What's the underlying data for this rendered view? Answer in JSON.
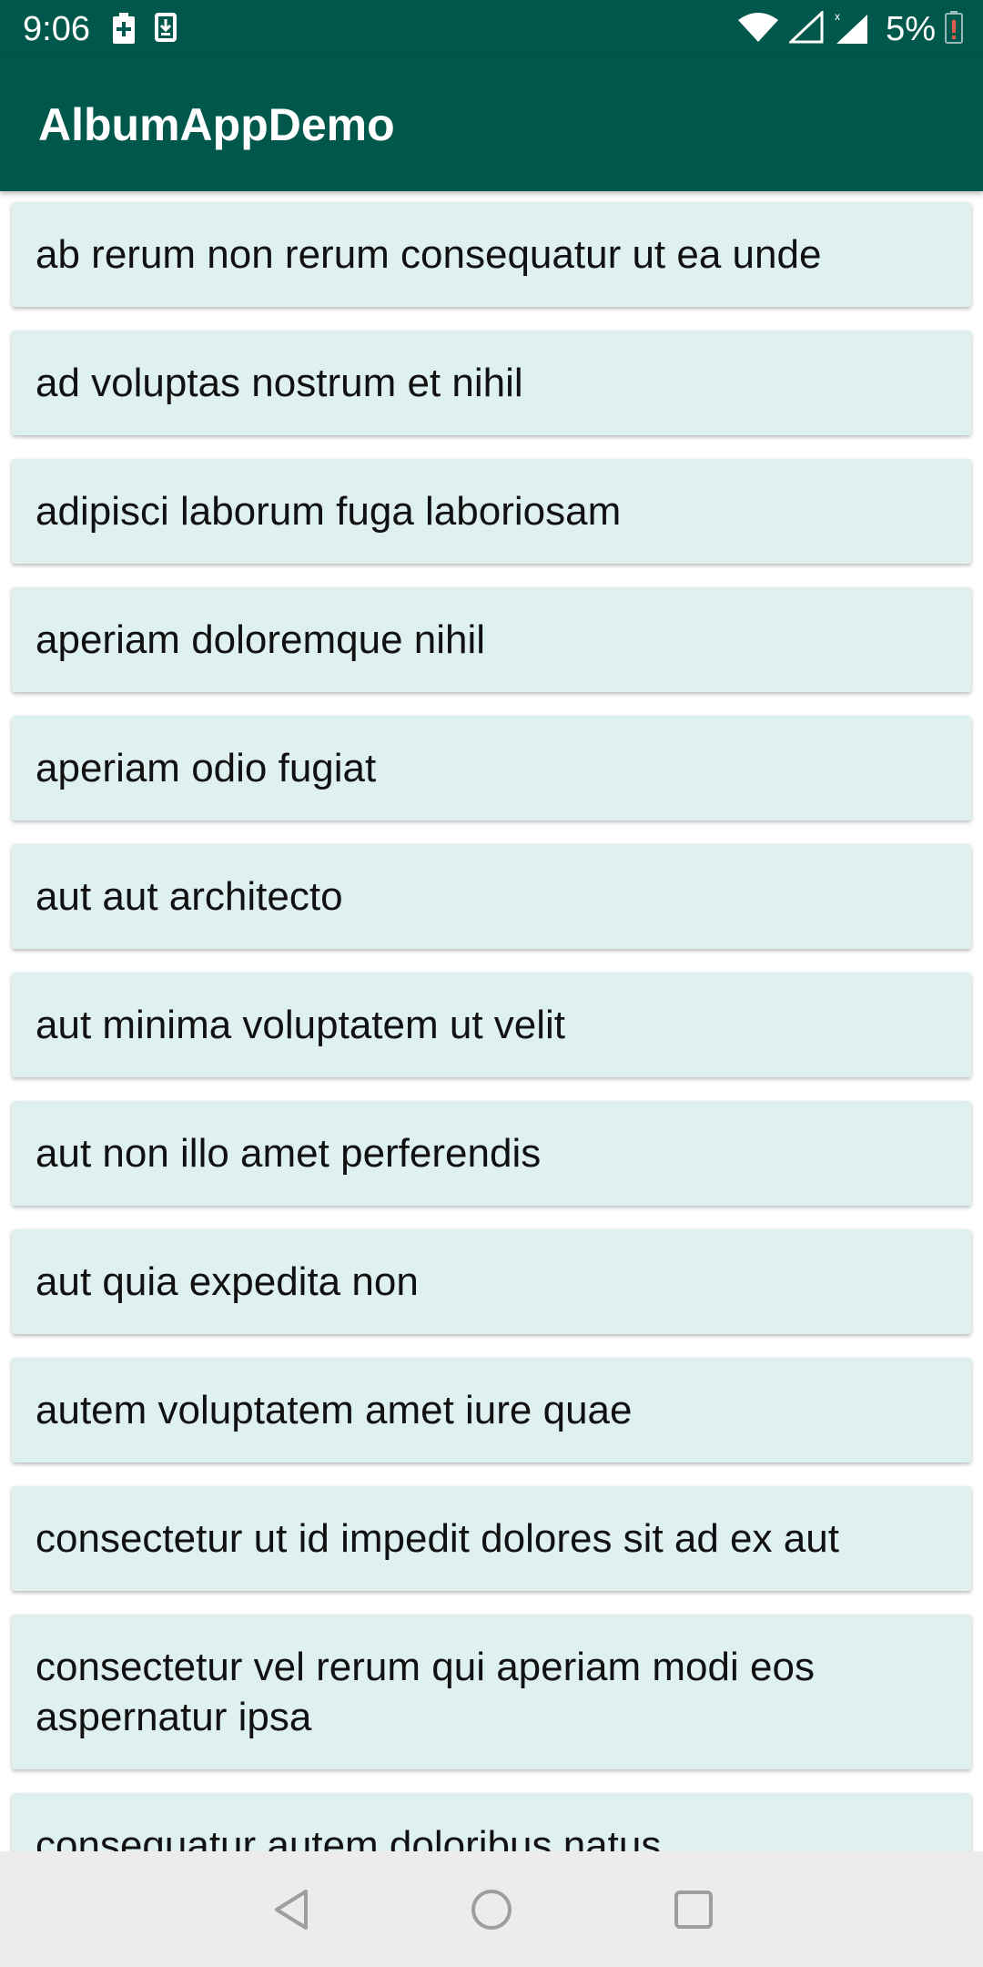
{
  "status_bar": {
    "time": "9:06",
    "battery_percent": "5%",
    "icons": [
      "battery-saver-icon",
      "download-icon",
      "wifi-icon",
      "signal-icon",
      "battery-icon"
    ]
  },
  "app_bar": {
    "title": "AlbumAppDemo"
  },
  "albums": [
    "ab rerum non rerum consequatur ut ea unde",
    "ad voluptas nostrum et nihil",
    "adipisci laborum fuga laboriosam",
    "aperiam doloremque nihil",
    "aperiam odio fugiat",
    "aut aut architecto",
    "aut minima voluptatem ut velit",
    "aut non illo amet perferendis",
    "aut quia expedita non",
    "autem voluptatem amet iure quae",
    "consectetur ut id impedit dolores sit ad ex aut",
    "consectetur vel rerum qui aperiam modi eos aspernatur ipsa",
    "consequatur autem doloribus natus"
  ],
  "colors": {
    "primary_dark": "#00574b",
    "card_background": "#dff0f0",
    "nav_background": "#ececec"
  },
  "nav_bar": {
    "icons": [
      "back-icon",
      "home-icon",
      "recents-icon"
    ]
  }
}
